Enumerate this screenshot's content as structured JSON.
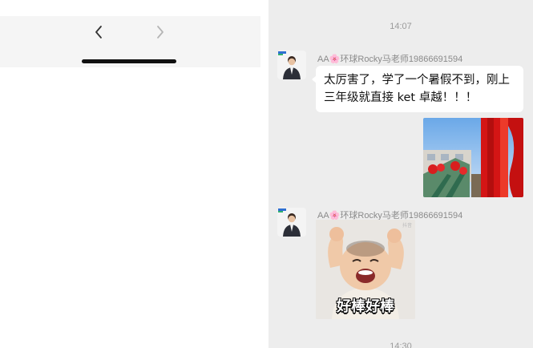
{
  "browser_nav": {
    "back_glyph": "‹",
    "forward_glyph": "›"
  },
  "chat": {
    "timestamps": [
      "14:07",
      "14:30"
    ],
    "messages": [
      {
        "sender": "AA🌸环球Rocky马老师19866691594",
        "type": "text",
        "text": "太厉害了，学了一个暑假不到，刚上三年级就直接 ket 卓越！！！"
      },
      {
        "sender": "",
        "type": "image",
        "description_icon": "photo-red-banners"
      },
      {
        "sender": "AA🌸环球Rocky马老师19866691594",
        "type": "sticker",
        "caption": "好棒好棒"
      }
    ]
  },
  "colors": {
    "chat_bg": "#ededed",
    "bubble_bg": "#ffffff",
    "nav_bg": "#f5f5f5"
  }
}
